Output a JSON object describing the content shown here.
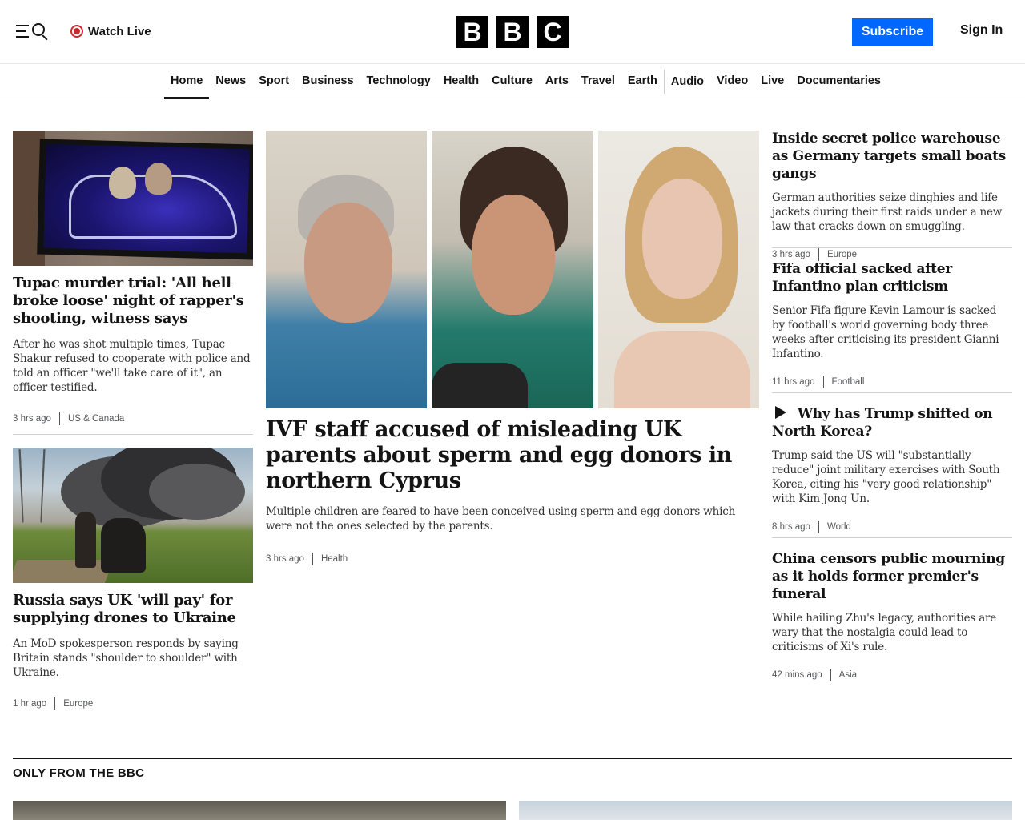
{
  "header": {
    "watch_live": "Watch Live",
    "logo_letters": [
      "B",
      "B",
      "C"
    ],
    "subscribe": "Subscribe",
    "sign_in": "Sign In"
  },
  "nav": {
    "items": [
      "Home",
      "News",
      "Sport",
      "Business",
      "Technology",
      "Health",
      "Culture",
      "Arts",
      "Travel",
      "Earth",
      "Audio",
      "Video",
      "Live",
      "Documentaries"
    ],
    "active": "Home"
  },
  "stories": {
    "tupac": {
      "headline": "Tupac murder trial: 'All hell broke loose' night of rapper's shooting, witness says",
      "summary": "After he was shot multiple times, Tupac Shakur refused to cooperate with police and told an officer \"we'll take care of it\", an officer testified.",
      "time": "3 hrs ago",
      "category": "US & Canada"
    },
    "russia": {
      "headline": "Russia says UK 'will pay' for supplying drones to Ukraine",
      "summary": "An MoD spokesperson responds by saying Britain stands \"shoulder to shoulder\" with Ukraine.",
      "time": "1 hr ago",
      "category": "Europe"
    },
    "ivf": {
      "headline": "IVF staff accused of misleading UK parents about sperm and egg donors in northern Cyprus",
      "summary": "Multiple children are feared to have been conceived using sperm and egg donors which were not the ones selected by the parents.",
      "time": "3 hrs ago",
      "category": "Health"
    },
    "germany": {
      "headline": "Inside secret police warehouse as Germany targets small boats gangs",
      "summary": "German authorities seize dinghies and life jackets during their first raids under a new law that cracks down on smuggling.",
      "time": "3 hrs ago",
      "category": "Europe"
    },
    "fifa": {
      "headline": "Fifa official sacked after Infantino plan criticism",
      "summary": "Senior Fifa figure Kevin Lamour is sacked by football's world governing body three weeks after criticising its president Gianni Infantino.",
      "time": "11 hrs ago",
      "category": "Football"
    },
    "korea": {
      "headline": "Why has Trump shifted on North Korea?",
      "summary": "Trump said the US will \"substantially reduce\" joint military exercises with South Korea, citing his \"very good relationship\" with Kim Jong Un.",
      "time": "8 hrs ago",
      "category": "World"
    },
    "china": {
      "headline": "China censors public mourning as it holds former premier's funeral",
      "summary": "While hailing Zhu's legacy, authorities are wary that the nostalgia could lead to criticisms of Xi's rule.",
      "time": "42 mins ago",
      "category": "Asia"
    }
  },
  "section": {
    "title": "ONLY FROM THE BBC"
  },
  "colors": {
    "brand_black": "#000000",
    "subscribe_blue": "#0068ff",
    "live_red": "#d6242d"
  }
}
